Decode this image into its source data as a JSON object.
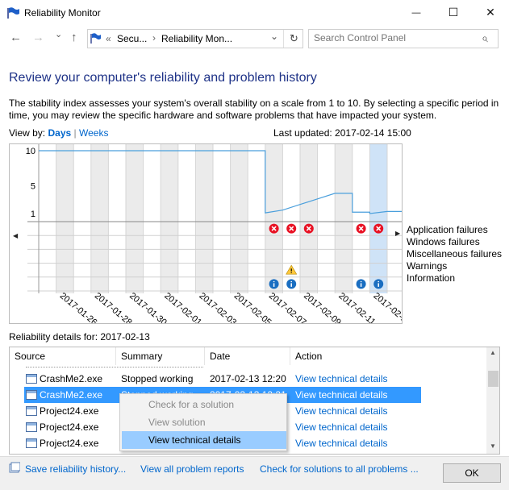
{
  "window": {
    "title": "Reliability Monitor",
    "minimize_glyph": "—",
    "maximize_glyph": "☐",
    "close_glyph": "✕"
  },
  "nav": {
    "back_glyph": "←",
    "forward_glyph": "→",
    "down_glyph": "⌄",
    "up_glyph": "↑",
    "breadcrumb_chevrons": "«",
    "breadcrumb_1": "Secu...",
    "breadcrumb_sep": "›",
    "breadcrumb_2": "Reliability Mon...",
    "breadcrumb_dropdown_glyph": "⌄",
    "refresh_glyph": "↻",
    "search_placeholder": "Search Control Panel",
    "search_glyph": "⌕"
  },
  "heading": "Review your computer's reliability and problem history",
  "description": "The stability index assesses your system's overall stability on a scale from 1 to 10. By selecting a specific period in time, you may review the specific hardware and software problems that have impacted your system.",
  "view_by": {
    "label": "View by:",
    "days": "Days",
    "separator": "|",
    "weeks": "Weeks"
  },
  "last_updated": "Last updated: 2017-02-14 15:00",
  "chart_data": {
    "type": "line",
    "y_ticks": [
      "10",
      "5",
      "1"
    ],
    "ylim": [
      1,
      10
    ],
    "x_tick_labels": [
      "2017-01-26",
      "2017-01-28",
      "2017-01-30",
      "2017-02-01",
      "2017-02-03",
      "2017-02-05",
      "2017-02-07",
      "2017-02-09",
      "2017-02-11",
      "2017-02-13"
    ],
    "stability_index": [
      10,
      10,
      10,
      10,
      10,
      10,
      10,
      10,
      10,
      10,
      10,
      10,
      10,
      10,
      10,
      10,
      10,
      10,
      10,
      10,
      10,
      10,
      10,
      10,
      10,
      10,
      10,
      10,
      10,
      10,
      10,
      10,
      10,
      10,
      10,
      10,
      10,
      10,
      10,
      10,
      10,
      10,
      10,
      10,
      10,
      10,
      10,
      10,
      10,
      10,
      10,
      10,
      10,
      10,
      10,
      10,
      10,
      10,
      10,
      10,
      10,
      10,
      10,
      10,
      10,
      10,
      10,
      10,
      10,
      10,
      10,
      10,
      10,
      10,
      10,
      10,
      10,
      10,
      10,
      10,
      10,
      10,
      10,
      10,
      10,
      10,
      10,
      10,
      10,
      10,
      10,
      10,
      10,
      10,
      10,
      10,
      10,
      10,
      10,
      10,
      10,
      10,
      10,
      10,
      10,
      10,
      10,
      10,
      10,
      10,
      10,
      10,
      10,
      10,
      10,
      10,
      10,
      10,
      10,
      10,
      10,
      10,
      10,
      10,
      10,
      10,
      10,
      10,
      10,
      10,
      10,
      10,
      10,
      10,
      10,
      10,
      10,
      10,
      10,
      10,
      10,
      10,
      10,
      10,
      10,
      10,
      10,
      10,
      10,
      10,
      10,
      10,
      10,
      10,
      10,
      10,
      10,
      10,
      10,
      10,
      10,
      10,
      10,
      10,
      10,
      10,
      10,
      10,
      10,
      10,
      10,
      10,
      10,
      10,
      10,
      10,
      10,
      10,
      10,
      10,
      10,
      10,
      10,
      10,
      10,
      10,
      10,
      10,
      10,
      10,
      10,
      10,
      10,
      10,
      10,
      10,
      10,
      10,
      10,
      10,
      10,
      10,
      10,
      10,
      10,
      10,
      10,
      10,
      10,
      10,
      10,
      10,
      10,
      10,
      10,
      10,
      10,
      10,
      10,
      10,
      10,
      10,
      10,
      10,
      10,
      10,
      10,
      10,
      10,
      10,
      10,
      10,
      10,
      10,
      10,
      10,
      10,
      10,
      10,
      10,
      10,
      10,
      10,
      10,
      10,
      10,
      10,
      10,
      10,
      10,
      10,
      10,
      10,
      10,
      10,
      10,
      10,
      10,
      10,
      10,
      10,
      10,
      10,
      10,
      10,
      10,
      10,
      10,
      10,
      10,
      10,
      10,
      10,
      10,
      10,
      10,
      10,
      10,
      10,
      10,
      10,
      10,
      10,
      10,
      10,
      10,
      10,
      10,
      10,
      10,
      10,
      10,
      10,
      10,
      10,
      10,
      10,
      10,
      10,
      10,
      10,
      10,
      10,
      10,
      10,
      10,
      10,
      10,
      10,
      10,
      10,
      10,
      10,
      10,
      10
    ],
    "stability_days": [
      {
        "day": "2017-01-25",
        "value": 10
      },
      {
        "day": "2017-01-26",
        "value": 10
      },
      {
        "day": "2017-01-27",
        "value": 10
      },
      {
        "day": "2017-01-28",
        "value": 10
      },
      {
        "day": "2017-01-29",
        "value": 10
      },
      {
        "day": "2017-01-30",
        "value": 10
      },
      {
        "day": "2017-01-31",
        "value": 10
      },
      {
        "day": "2017-02-01",
        "value": 10
      },
      {
        "day": "2017-02-02",
        "value": 10
      },
      {
        "day": "2017-02-03",
        "value": 10
      },
      {
        "day": "2017-02-04",
        "value": 10
      },
      {
        "day": "2017-02-05",
        "value": 10
      },
      {
        "day": "2017-02-06",
        "value": 10
      },
      {
        "day": "2017-02-07",
        "value": 1.1
      },
      {
        "day": "2017-02-08",
        "value": 1.5
      },
      {
        "day": "2017-02-09",
        "value": 2.3
      },
      {
        "day": "2017-02-10",
        "value": 3.1
      },
      {
        "day": "2017-02-11",
        "value": 3.9
      },
      {
        "day": "2017-02-12",
        "value": 1.2
      },
      {
        "day": "2017-02-13",
        "value": 1.0
      },
      {
        "day": "2017-02-14",
        "value": 1.3
      }
    ],
    "legend": [
      "Application failures",
      "Windows failures",
      "Miscellaneous failures",
      "Warnings",
      "Information"
    ],
    "events": {
      "application_failures_days": [
        "2017-02-07",
        "2017-02-08",
        "2017-02-09",
        "2017-02-12",
        "2017-02-13"
      ],
      "warnings_days": [
        "2017-02-08"
      ],
      "information_days": [
        "2017-02-07",
        "2017-02-08",
        "2017-02-12",
        "2017-02-13"
      ]
    },
    "selected_day": "2017-02-13",
    "colors": {
      "line": "#4a9fdc",
      "selected_column": "#cfe3f7",
      "error": "#e81123",
      "warning": "#ffc83d",
      "info": "#1a6ec1"
    }
  },
  "scroll": {
    "left_glyph": "◀",
    "right_glyph": "▶",
    "up_glyph": "▲",
    "down_glyph": "▼"
  },
  "details": {
    "label": "Reliability details for: 2017-02-13",
    "columns": [
      "Source",
      "Summary",
      "Date",
      "Action"
    ],
    "rows": [
      {
        "source": "CrashMe2.exe",
        "summary": "Stopped working",
        "date": "2017-02-13 12:20",
        "action": "View  technical details"
      },
      {
        "source": "CrashMe2.exe",
        "summary": "Stopped working",
        "date": "2017-02-13 12:21",
        "action": "View  technical details"
      },
      {
        "source": "Project24.exe",
        "summary": "",
        "date": "",
        "action": "View  technical details"
      },
      {
        "source": "Project24.exe",
        "summary": "",
        "date": "",
        "action": "View  technical details"
      },
      {
        "source": "Project24.exe",
        "summary": "",
        "date": "",
        "action": "View  technical details"
      }
    ]
  },
  "context_menu": {
    "items": [
      "Check for a solution",
      "View solution",
      "View technical details"
    ]
  },
  "footer": {
    "save_history": "Save reliability history...",
    "view_all": "View all problem reports",
    "check_solutions": "Check for solutions to all problems ...",
    "ok": "OK"
  }
}
